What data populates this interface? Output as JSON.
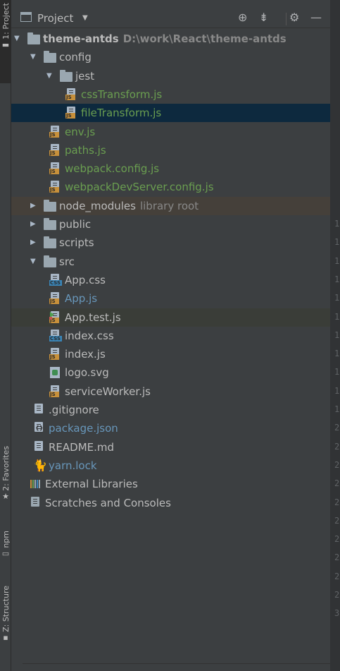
{
  "sidebar": {
    "tabs": [
      {
        "label": "1: Project"
      },
      {
        "label": "2: Favorites"
      },
      {
        "label": "npm"
      },
      {
        "label": "Z: Structure"
      }
    ]
  },
  "panel": {
    "title": "Project",
    "icons": [
      "target-icon",
      "collapse-all-icon",
      "gear-icon",
      "minimize-icon"
    ]
  },
  "tree": [
    {
      "label": "theme-antds",
      "sub": "D:\\work\\React\\theme-antds",
      "type": "folder",
      "depth": 0,
      "expanded": true,
      "color": "#bbbbbb",
      "bold": true
    },
    {
      "label": "config",
      "type": "folder",
      "depth": 1,
      "expanded": true,
      "color": "#bbbbbb"
    },
    {
      "label": "jest",
      "type": "folder",
      "depth": 2,
      "expanded": true,
      "color": "#bbbbbb"
    },
    {
      "label": "cssTransform.js",
      "type": "js",
      "depth": 3,
      "color": "#6a9e50"
    },
    {
      "label": "fileTransform.js",
      "type": "js",
      "depth": 3,
      "color": "#6a9e50",
      "selected": true
    },
    {
      "label": "env.js",
      "type": "js",
      "depth": 2,
      "color": "#6a9e50"
    },
    {
      "label": "paths.js",
      "type": "js",
      "depth": 2,
      "color": "#6a9e50"
    },
    {
      "label": "webpack.config.js",
      "type": "js",
      "depth": 2,
      "color": "#6a9e50"
    },
    {
      "label": "webpackDevServer.config.js",
      "type": "js",
      "depth": 2,
      "color": "#6a9e50"
    },
    {
      "label": "node_modules",
      "sub": "library root",
      "type": "folder",
      "depth": 1,
      "expanded": false,
      "color": "#bbbbbb",
      "highlight": "brown"
    },
    {
      "label": "public",
      "type": "folder",
      "depth": 1,
      "expanded": false,
      "color": "#bbbbbb"
    },
    {
      "label": "scripts",
      "type": "folder",
      "depth": 1,
      "expanded": false,
      "color": "#bbbbbb"
    },
    {
      "label": "src",
      "type": "folder",
      "depth": 1,
      "expanded": true,
      "color": "#bbbbbb"
    },
    {
      "label": "App.css",
      "type": "css",
      "depth": 2,
      "color": "#bbbbbb"
    },
    {
      "label": "App.js",
      "type": "js",
      "depth": 2,
      "color": "#6897bb"
    },
    {
      "label": "App.test.js",
      "type": "jstest",
      "depth": 2,
      "color": "#bbbbbb",
      "highlight": "green"
    },
    {
      "label": "index.css",
      "type": "css",
      "depth": 2,
      "color": "#bbbbbb"
    },
    {
      "label": "index.js",
      "type": "js",
      "depth": 2,
      "color": "#bbbbbb"
    },
    {
      "label": "logo.svg",
      "type": "svg",
      "depth": 2,
      "color": "#bbbbbb"
    },
    {
      "label": "serviceWorker.js",
      "type": "js",
      "depth": 2,
      "color": "#bbbbbb"
    },
    {
      "label": ".gitignore",
      "type": "text",
      "depth": 1,
      "color": "#bbbbbb"
    },
    {
      "label": "package.json",
      "type": "json",
      "depth": 1,
      "color": "#6897bb"
    },
    {
      "label": "README.md",
      "type": "text",
      "depth": 1,
      "color": "#bbbbbb"
    },
    {
      "label": "yarn.lock",
      "type": "yarn",
      "depth": 1,
      "color": "#6897bb"
    },
    {
      "label": "External Libraries",
      "type": "lib",
      "depth": 0,
      "color": "#bbbbbb"
    },
    {
      "label": "Scratches and Consoles",
      "type": "scratch",
      "depth": 0,
      "color": "#bbbbbb"
    }
  ],
  "gutter": [
    "1",
    "1",
    "1",
    "1",
    "1",
    "1",
    "1",
    "1",
    "1",
    "1",
    "1",
    "2",
    "2",
    "2",
    "2",
    "2",
    "2",
    "2",
    "2",
    "2",
    "2",
    "3"
  ],
  "colors": {
    "selected": "#0d293e",
    "bg": "#3c3f41",
    "green": "#6a9e50",
    "blue": "#6897bb"
  }
}
